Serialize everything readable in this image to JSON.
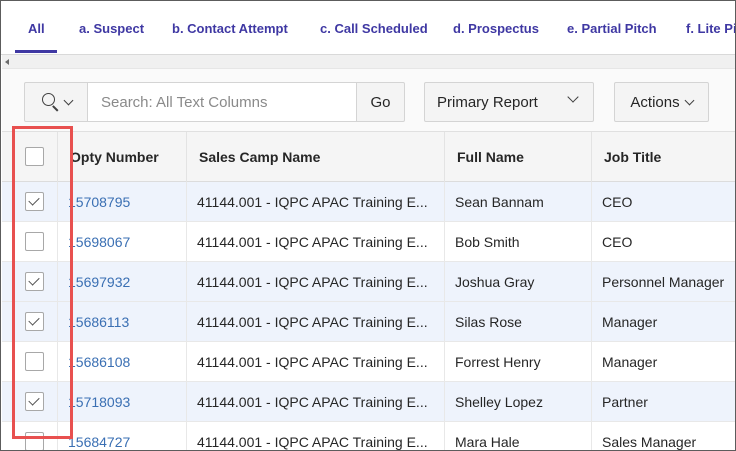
{
  "tabs": [
    {
      "label": "All"
    },
    {
      "label": "a. Suspect"
    },
    {
      "label": "b. Contact Attempt"
    },
    {
      "label": "c. Call Scheduled"
    },
    {
      "label": "d. Prospectus"
    },
    {
      "label": "e. Partial Pitch"
    },
    {
      "label": "f. Lite Pi"
    }
  ],
  "active_tab": "All",
  "toolbar": {
    "search_icon": "magnifier-icon",
    "search_placeholder": "Search: All Text Columns",
    "go_label": "Go",
    "report_label": "Primary Report",
    "actions_label": "Actions"
  },
  "columns": [
    "",
    "Opty Number",
    "Sales Camp Name",
    "Full Name",
    "Job Title"
  ],
  "rows": [
    {
      "checked": true,
      "opty": "15708795",
      "camp": "41144.001 - IQPC APAC Training E...",
      "name": "Sean Bannam",
      "title": "CEO"
    },
    {
      "checked": false,
      "opty": "15698067",
      "camp": "41144.001 - IQPC APAC Training E...",
      "name": "Bob Smith",
      "title": "CEO"
    },
    {
      "checked": true,
      "opty": "15697932",
      "camp": "41144.001 - IQPC APAC Training E...",
      "name": "Joshua Gray",
      "title": "Personnel Manager"
    },
    {
      "checked": true,
      "opty": "15686113",
      "camp": "41144.001 - IQPC APAC Training E...",
      "name": "Silas Rose",
      "title": "Manager"
    },
    {
      "checked": false,
      "opty": "15686108",
      "camp": "41144.001 - IQPC APAC Training E...",
      "name": "Forrest Henry",
      "title": "Manager"
    },
    {
      "checked": true,
      "opty": "15718093",
      "camp": "41144.001 - IQPC APAC Training E...",
      "name": "Shelley Lopez",
      "title": "Partner"
    },
    {
      "checked": false,
      "opty": "15684727",
      "camp": "41144.001 - IQPC APAC Training E...",
      "name": "Mara Hale",
      "title": "Sales Manager"
    }
  ],
  "colors": {
    "tab_text": "#3f38a3",
    "link": "#3a6fb3",
    "selected_row": "#eef3fc",
    "highlight_box": "#e8504f"
  }
}
